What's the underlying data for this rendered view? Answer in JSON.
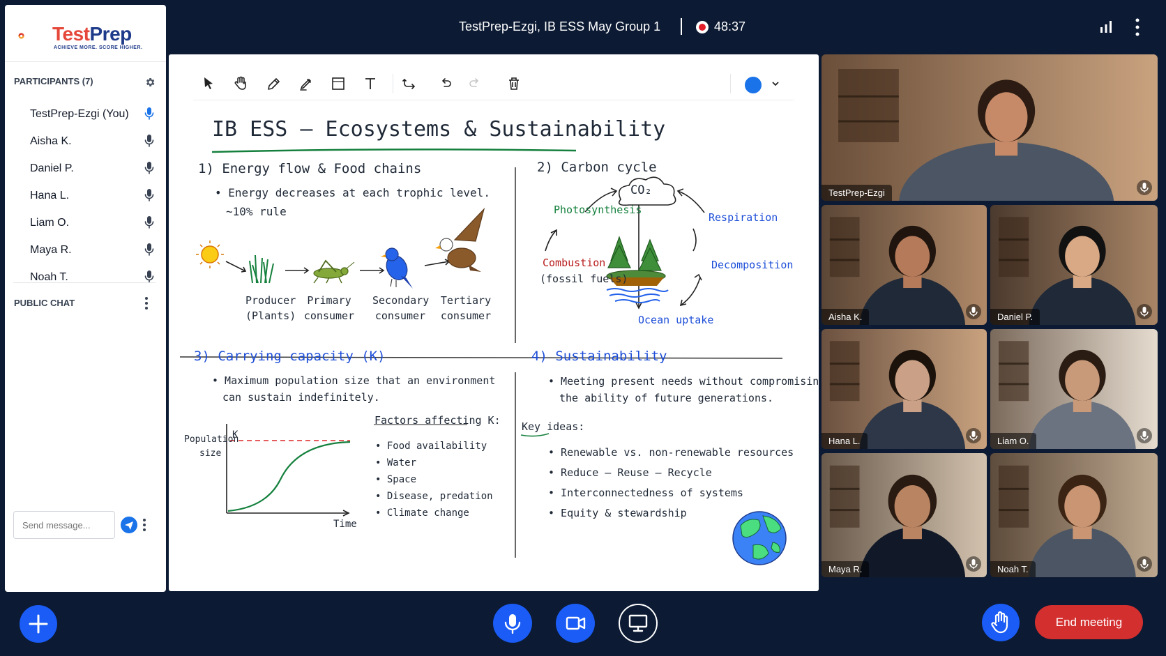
{
  "meeting": {
    "title": "TestPrep-Ezgi, IB ESS May Group 1",
    "record_time": "48:37"
  },
  "brand": {
    "name_a": "Test",
    "name_b": "Prep",
    "tagline": "ACHIEVE MORE. SCORE HIGHER."
  },
  "participants": {
    "header": "PARTICIPANTS (7)",
    "items": [
      {
        "name": "TestPrep-Ezgi (You)",
        "mic_active": true
      },
      {
        "name": "Aisha K.",
        "mic_active": false
      },
      {
        "name": "Daniel P.",
        "mic_active": false
      },
      {
        "name": "Hana L.",
        "mic_active": false
      },
      {
        "name": "Liam O.",
        "mic_active": false
      },
      {
        "name": "Maya R.",
        "mic_active": false
      },
      {
        "name": "Noah T.",
        "mic_active": false
      }
    ]
  },
  "chat": {
    "header": "PUBLIC CHAT",
    "placeholder": "Send message..."
  },
  "whiteboard": {
    "title": "IB ESS – Ecosystems & Sustainability",
    "s1": {
      "heading": "1) Energy flow & Food chains",
      "bullet1": "• Energy decreases at each trophic level.",
      "bullet2": "~10% rule",
      "producer1": "Producer",
      "producer2": "(Plants)",
      "primary1": "Primary",
      "primary2": "consumer",
      "secondary1": "Secondary",
      "secondary2": "consumer",
      "tertiary1": "Tertiary",
      "tertiary2": "consumer"
    },
    "s2": {
      "heading": "2) Carbon cycle",
      "co2": "CO₂",
      "photosynthesis": "Photosynthesis",
      "respiration": "Respiration",
      "combustion1": "Combustion",
      "combustion2": "(fossil fuels)",
      "decomposition": "Decomposition",
      "ocean": "Ocean uptake"
    },
    "s3": {
      "heading": "3) Carrying capacity (K)",
      "bullet1": "• Maximum population size that an environment",
      "bullet2": "can sustain indefinitely.",
      "ylabel1": "Population",
      "ylabel2": "size",
      "k": "K",
      "xlabel": "Time",
      "factors_title": "Factors affecting K:",
      "factors": [
        "• Food availability",
        "• Water",
        "• Space",
        "• Disease, predation",
        "• Climate change"
      ]
    },
    "s4": {
      "heading": "4) Sustainability",
      "bullet1": "• Meeting present needs without compromising",
      "bullet2": "the ability of future generations.",
      "key_title": "Key ideas:",
      "ideas": [
        "• Renewable vs. non-renewable resources",
        "• Reduce – Reuse – Recycle",
        "• Interconnectedness of systems",
        "• Equity & stewardship"
      ]
    }
  },
  "videos": [
    {
      "name": "TestPrep-Ezgi"
    },
    {
      "name": "Aisha K."
    },
    {
      "name": "Daniel P."
    },
    {
      "name": "Hana L."
    },
    {
      "name": "Liam O."
    },
    {
      "name": "Maya R."
    },
    {
      "name": "Noah T."
    }
  ],
  "controls": {
    "end_label": "End meeting"
  },
  "colors": {
    "accent": "#1a73e8",
    "end": "#d32f2f",
    "background": "#0c1a33",
    "record": "#e11d2a"
  }
}
